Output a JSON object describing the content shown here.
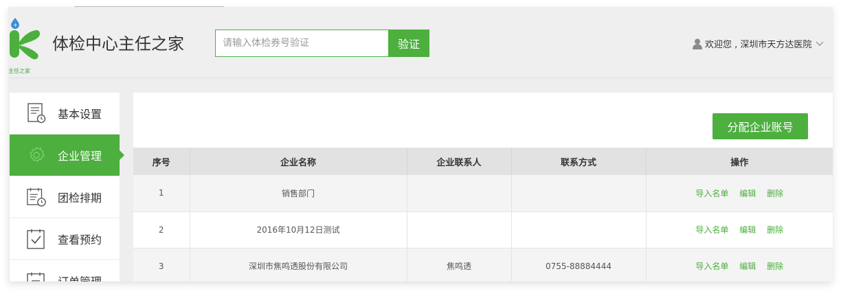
{
  "header": {
    "logo_caption": "主任之家",
    "app_title": "体检中心主任之家",
    "search": {
      "placeholder": "请输入体检券号验证",
      "value": "",
      "button_label": "验证"
    },
    "user": {
      "greeting": "欢迎您 , 深圳市天方达医院"
    }
  },
  "sidebar": {
    "items": [
      {
        "label": "基本设置",
        "icon": "settings-doc-icon",
        "active": false
      },
      {
        "label": "企业管理",
        "icon": "gear-icon",
        "active": true
      },
      {
        "label": "团检排期",
        "icon": "schedule-icon",
        "active": false
      },
      {
        "label": "查看预约",
        "icon": "checklist-icon",
        "active": false
      },
      {
        "label": "订单管理",
        "icon": "order-icon",
        "active": false
      }
    ]
  },
  "main": {
    "assign_button": "分配企业账号",
    "table": {
      "headers": [
        "序号",
        "企业名称",
        "企业联系人",
        "联系方式",
        "操作"
      ],
      "rows": [
        {
          "no": "1",
          "name": "销售部门",
          "contact": "",
          "phone": ""
        },
        {
          "no": "2",
          "name": "2016年10月12日测试",
          "contact": "",
          "phone": ""
        },
        {
          "no": "3",
          "name": "深圳市焦鸣透股份有限公司",
          "contact": "焦鸣透",
          "phone": "0755-88884444"
        }
      ],
      "actions": {
        "import": "导入名单",
        "edit": "编辑",
        "delete": "删除"
      }
    }
  },
  "colors": {
    "accent": "#4caf3e",
    "header_bg": "#efefef",
    "table_header_bg": "#e2e2e2"
  }
}
